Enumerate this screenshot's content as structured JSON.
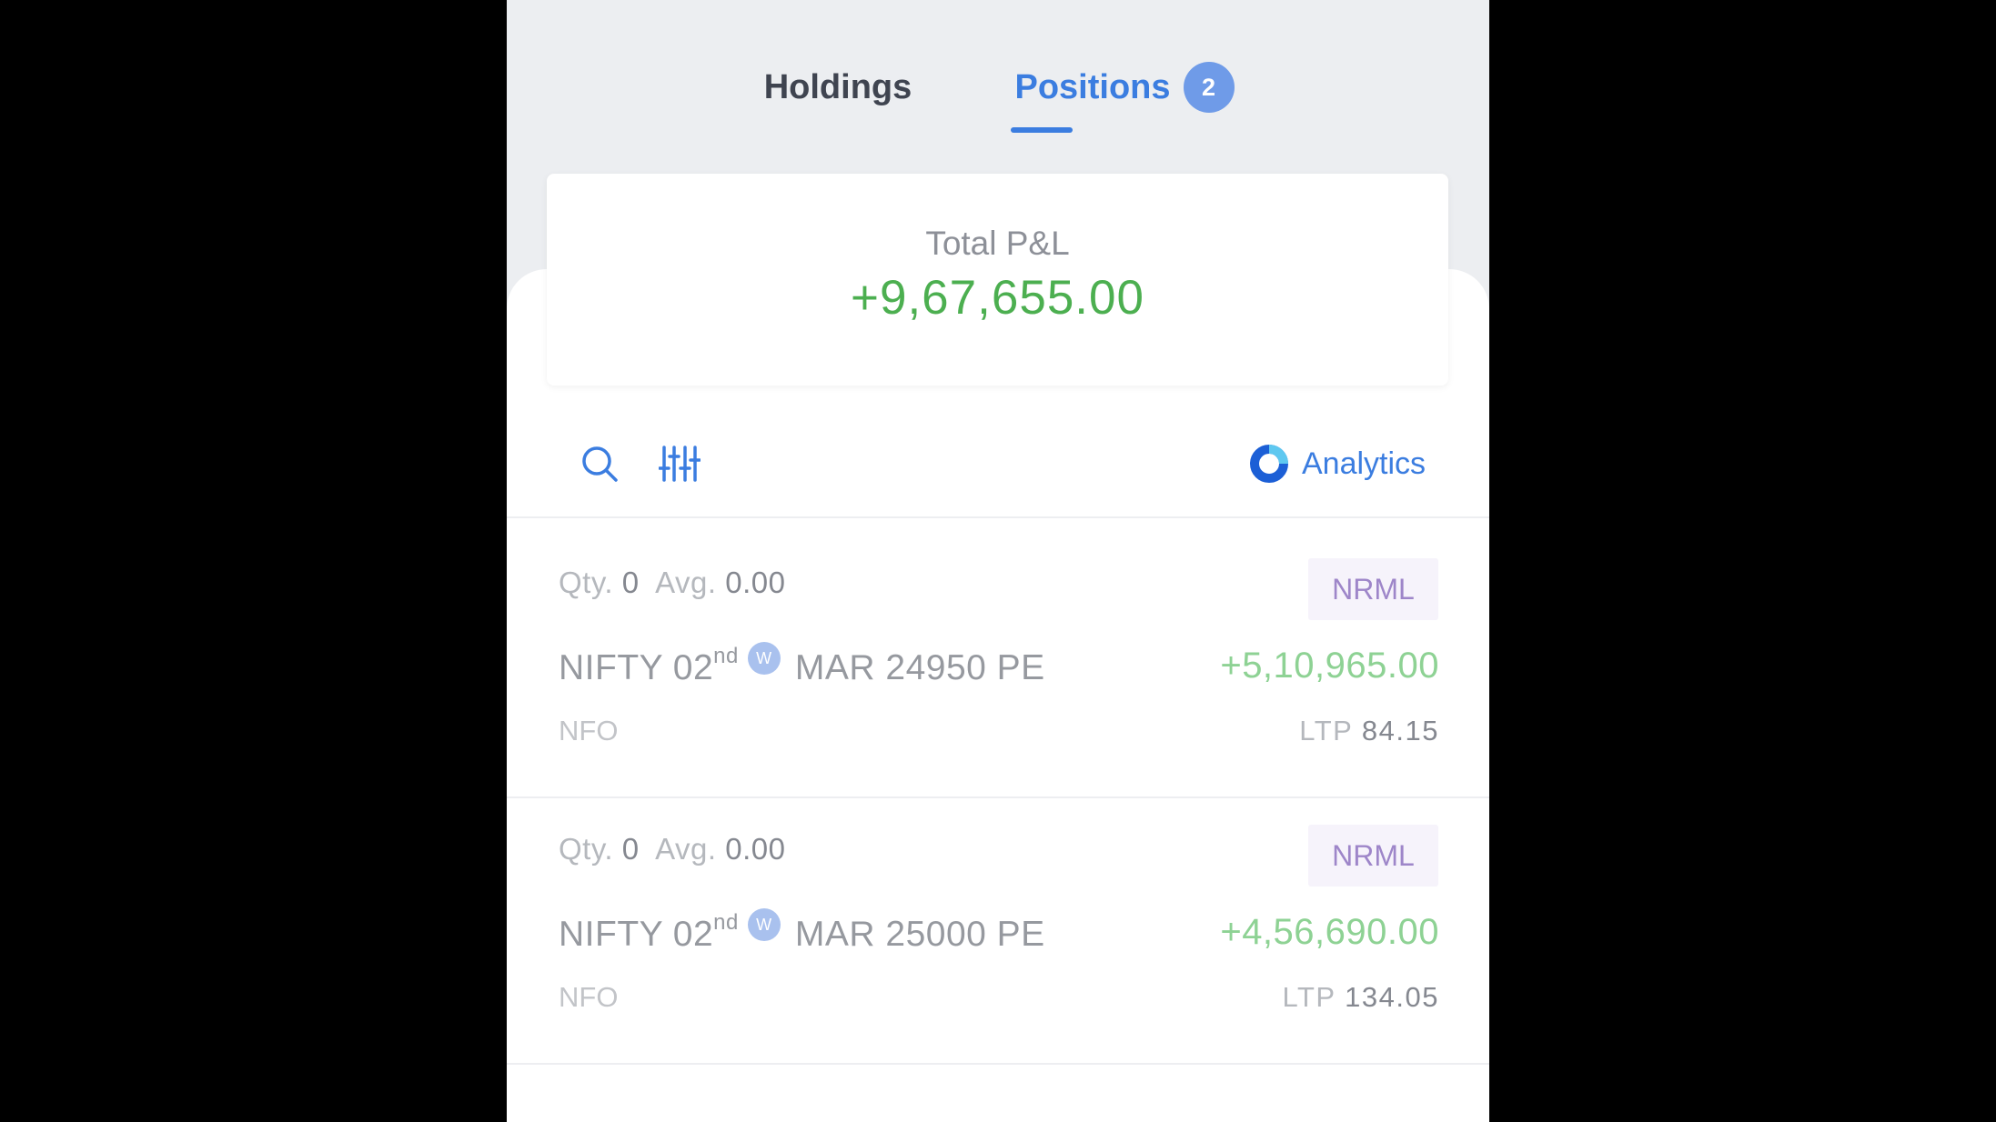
{
  "tabs": [
    {
      "label": "Holdings",
      "active": false
    },
    {
      "label": "Positions",
      "active": true,
      "badge": "2"
    }
  ],
  "summary": {
    "label": "Total P&L",
    "value": "+9,67,655.00",
    "value_color": "#4caf50"
  },
  "toolbar": {
    "search_icon": "search-icon",
    "filter_icon": "sliders-icon",
    "analytics_label": "Analytics",
    "analytics_icon": "analytics-ring-icon"
  },
  "positions": [
    {
      "qty_label": "Qty.",
      "qty": "0",
      "avg_label": "Avg.",
      "avg": "0.00",
      "product": "NRML",
      "symbol_prefix": "NIFTY 02",
      "symbol_sup": "nd",
      "weekly_badge": "W",
      "symbol_suffix": "MAR 24950 PE",
      "pnl": "+5,10,965.00",
      "exchange": "NFO",
      "ltp_label": "LTP",
      "ltp": "84.15"
    },
    {
      "qty_label": "Qty.",
      "qty": "0",
      "avg_label": "Avg.",
      "avg": "0.00",
      "product": "NRML",
      "symbol_prefix": "NIFTY 02",
      "symbol_sup": "nd",
      "weekly_badge": "W",
      "symbol_suffix": "MAR 25000 PE",
      "pnl": "+4,56,690.00",
      "exchange": "NFO",
      "ltp_label": "LTP",
      "ltp": "134.05"
    }
  ],
  "colors": {
    "accent": "#3b7de0",
    "profit": "#4caf50",
    "product_badge": "#9e86c9"
  }
}
